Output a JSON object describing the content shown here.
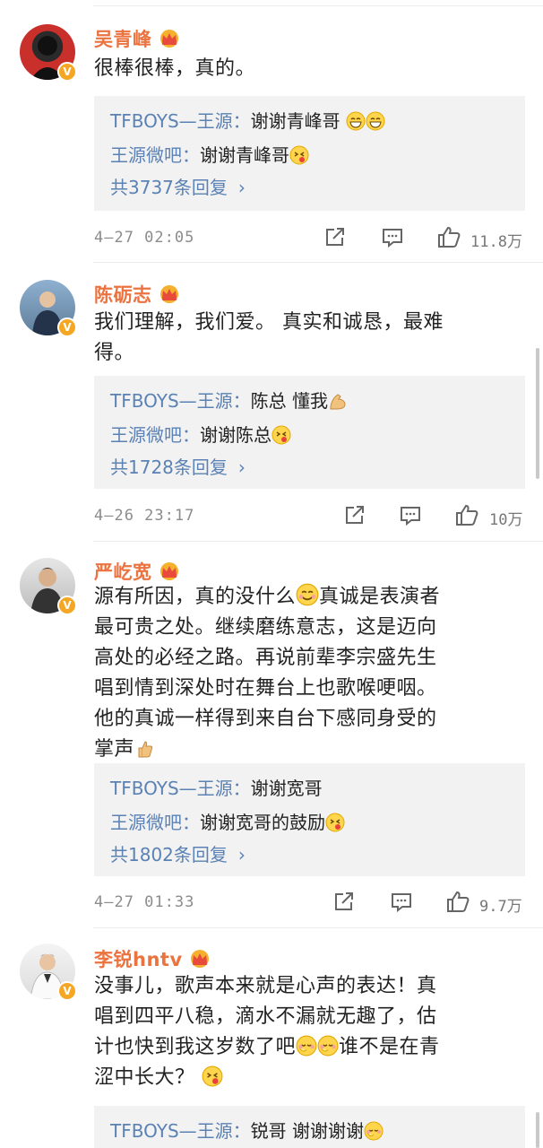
{
  "comments": [
    {
      "username": "吴青峰",
      "text": "很棒很棒，真的。",
      "replies": [
        {
          "user": "TFBOYS—王源：",
          "text": "谢谢青峰哥 ",
          "emoji": "grin-grin"
        },
        {
          "user": "王源微吧：",
          "text": "谢谢青峰哥",
          "emoji": "kiss"
        }
      ],
      "more": "共3737条回复",
      "time": "4—27 02:05",
      "likes": "11.8万"
    },
    {
      "username": "陈砺志",
      "text_lines": [
        "我们理解，我们爱。 真实和诚恳，最难",
        "得。"
      ],
      "replies": [
        {
          "user": "TFBOYS—王源：",
          "text": "陈总 懂我",
          "emoji": "muscle"
        },
        {
          "user": "王源微吧：",
          "text": "谢谢陈总",
          "emoji": "kiss"
        }
      ],
      "more": "共1728条回复",
      "time": "4—26 23:17",
      "likes": "10万"
    },
    {
      "username": "严屹宽",
      "text_lines": [
        "源有所因，真的没什么",
        "真诚是表演者",
        "最可贵之处。继续磨练意志，这是迈向",
        "高处的必经之路。再说前辈李宗盛先生",
        "唱到情到深处时在舞台上也歌喉哽咽。",
        "他的真诚一样得到来自台下感同身受的",
        "掌声"
      ],
      "replies": [
        {
          "user": "TFBOYS—王源：",
          "text": "谢谢宽哥",
          "emoji": ""
        },
        {
          "user": "王源微吧：",
          "text": "谢谢宽哥的鼓励",
          "emoji": "kiss"
        }
      ],
      "more": "共1802条回复",
      "time": "4—27 01:33",
      "likes": "9.7万"
    },
    {
      "username": "李锐hntv",
      "text_lines": [
        "没事儿，歌声本来就是心声的表达！真",
        "唱到四平八稳，滴水不漏就无趣了，估",
        "计也快到我这岁数了吧",
        "谁不是在青",
        "涩中长大？"
      ],
      "replies": [
        {
          "user": "TFBOYS—王源：",
          "text": "锐哥 谢谢谢谢",
          "emoji": "blush"
        }
      ]
    }
  ],
  "colors": {
    "username": "#eb7340",
    "link": "#5b82b4",
    "reply_bg": "#f2f2f2",
    "meta": "#8c8c8c"
  }
}
